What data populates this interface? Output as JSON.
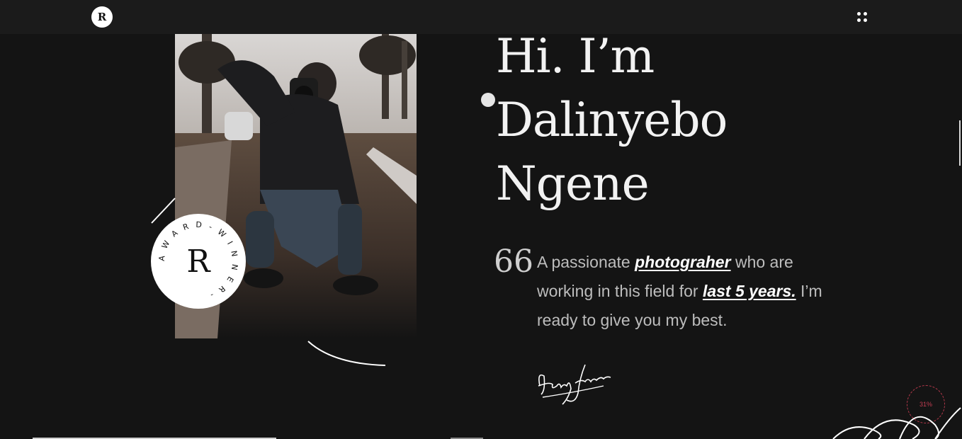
{
  "header": {
    "logo_letter": "R",
    "menu_icon": "grid-dots-icon"
  },
  "hero": {
    "headline_lines": [
      "Hi. I’m",
      "Dalinyebo",
      "Ngene"
    ],
    "quote_mark": "66",
    "bio": {
      "part1": "A passionate ",
      "link1": "photograher",
      "part2": " who are working in this field for ",
      "link2": "last 5 years.",
      "part3": " I’m ready to give you my best."
    },
    "signature": "Henry James"
  },
  "badge": {
    "ring_text": "A W A R D - W I N N E R - ",
    "letter": "R"
  },
  "scroll_progress": {
    "label": "31%",
    "value": 0.31
  },
  "colors": {
    "background": "#141414",
    "header": "#1b1b1b",
    "text": "#f2f2f2",
    "accent": "#c23d52"
  }
}
